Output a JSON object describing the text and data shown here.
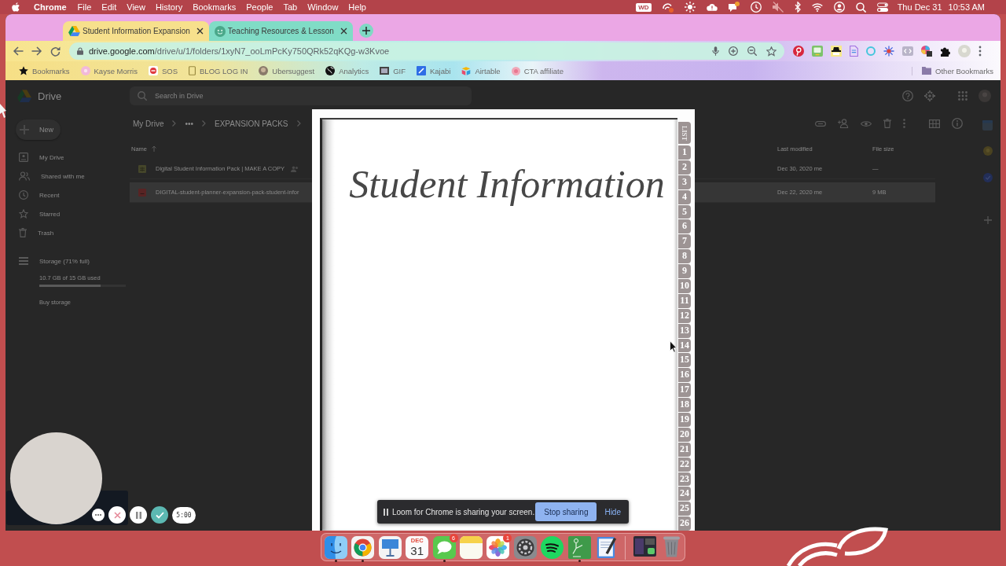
{
  "menubar": {
    "app": "Chrome",
    "menus": [
      "File",
      "Edit",
      "View",
      "History",
      "Bookmarks",
      "People",
      "Tab",
      "Window",
      "Help"
    ],
    "status_badge": "WD",
    "date": "Thu Dec 31",
    "time": "10:53 AM"
  },
  "tabs": [
    {
      "title": "Student Information Expansion",
      "selected": true
    },
    {
      "title": "Teaching Resources & Lesson",
      "selected": false
    }
  ],
  "address_bar": {
    "domain": "drive.google.com",
    "path": "/drive/u/1/folders/1xyN7_ooLmPcKy750QRk52qKQg-w3Kvoe"
  },
  "bookmarks": {
    "items": [
      "Bookmarks",
      "Kayse Morris",
      "SOS",
      "BLOG LOG IN",
      "Ubersuggest",
      "Analytics",
      "GIF",
      "Kajabi",
      "Airtable",
      "CTA affiliate"
    ],
    "other": "Other Bookmarks"
  },
  "drive": {
    "product": "Drive",
    "search_placeholder": "Search in Drive",
    "new_button": "New",
    "nav": [
      "My Drive",
      "Shared with me",
      "Recent",
      "Starred",
      "Trash"
    ],
    "storage": {
      "label": "Storage (71% full)",
      "usage": "10.7 GB of 15 GB used",
      "level": 0.71,
      "action": "Buy storage"
    },
    "breadcrumb": [
      "My Drive",
      "•••",
      "EXPANSION PACKS"
    ],
    "columns": [
      "Name",
      "Last modified",
      "File size"
    ],
    "rows": [
      {
        "kind": "sheet",
        "name": "Digital Student Information Pack | MAKE A COPY",
        "shared": true,
        "modified": "Dec 30, 2020 me",
        "size": "—",
        "selected": false
      },
      {
        "kind": "pdf",
        "name": "DIGITAL-student-planner-expansion-pack-student-infor",
        "shared": false,
        "modified": "Dec 22, 2020 me",
        "size": "9 MB",
        "selected": true
      }
    ]
  },
  "preview": {
    "title": "Student Information",
    "list_tab": "LIST",
    "number_tabs": [
      "1",
      "2",
      "3",
      "4",
      "5",
      "6",
      "7",
      "8",
      "9",
      "10",
      "11",
      "12",
      "13",
      "14",
      "15",
      "16",
      "17",
      "18",
      "19",
      "20",
      "21",
      "22",
      "23",
      "24",
      "25",
      "26"
    ]
  },
  "loom_bar": {
    "message": "Loom for Chrome is sharing your screen.",
    "stop": "Stop sharing",
    "hide": "Hide"
  },
  "loom_recorder": {
    "timer": "5:00"
  },
  "dock": {
    "apps": [
      {
        "kind": "icon",
        "running": true
      },
      {
        "kind": "icon",
        "running": true
      },
      {
        "kind": "icon",
        "running": false
      },
      {
        "kind": "calendar",
        "month": "DEC",
        "day": "31",
        "running": false
      },
      {
        "kind": "icon",
        "running": true,
        "badge": "6"
      },
      {
        "kind": "icon",
        "running": false
      },
      {
        "kind": "icon",
        "running": false,
        "badge": "1"
      },
      {
        "kind": "icon",
        "running": false
      },
      {
        "kind": "icon",
        "running": false
      },
      {
        "kind": "icon",
        "running": true
      },
      {
        "kind": "icon",
        "running": false
      }
    ]
  }
}
